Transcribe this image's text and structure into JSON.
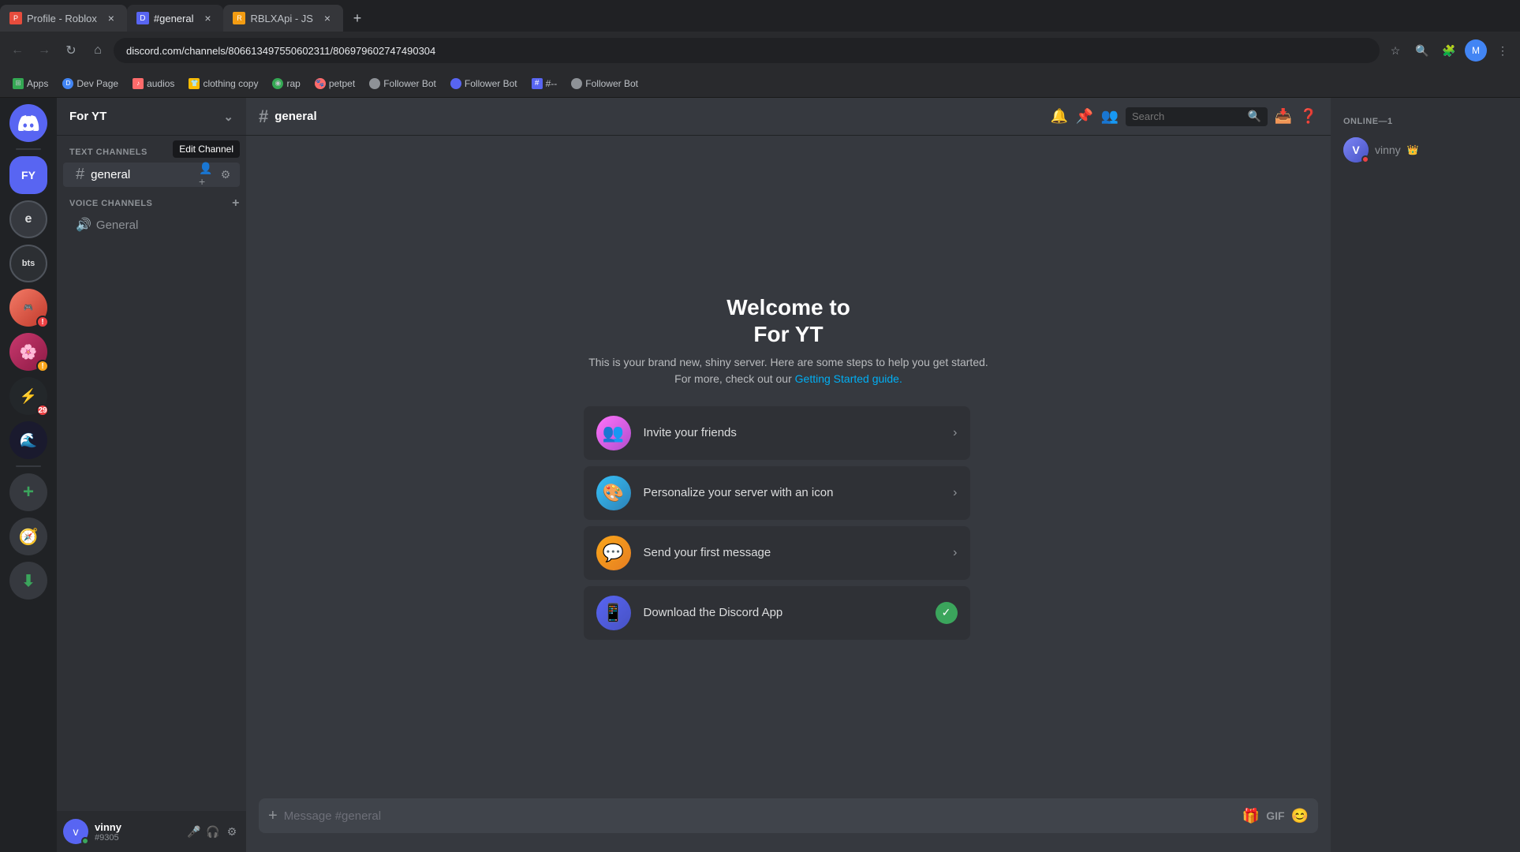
{
  "browser": {
    "tabs": [
      {
        "id": "tab1",
        "title": "Profile - Roblox",
        "url": "",
        "active": false,
        "favicon_color": "#e74c3c"
      },
      {
        "id": "tab2",
        "title": "#general",
        "url": "discord.com/channels/806613497550602311/806979602747490304",
        "active": true,
        "favicon_color": "#5865f2"
      },
      {
        "id": "tab3",
        "title": "RBLXApi - JS",
        "url": "",
        "active": false,
        "favicon_color": "#f39c12"
      }
    ],
    "address": "discord.com/channels/806613497550602311/806979602747490304",
    "bookmarks": [
      {
        "label": "Apps",
        "icon_color": "#34a853"
      },
      {
        "label": "Dev Page",
        "icon_color": "#4285f4"
      },
      {
        "label": "audios",
        "icon_color": "#ea4335"
      },
      {
        "label": "clothing copy",
        "icon_color": "#fbbc04"
      },
      {
        "label": "rap",
        "icon_color": "#34a853"
      },
      {
        "label": "petpet",
        "icon_color": "#ea4335"
      },
      {
        "label": "Follower Bot",
        "icon_color": "#8e9297"
      },
      {
        "label": "Follower Bot",
        "icon_color": "#8e9297"
      },
      {
        "label": "#--",
        "icon_color": "#5865f2"
      },
      {
        "label": "Follower Bot",
        "icon_color": "#8e9297"
      }
    ]
  },
  "discord": {
    "server_name": "For YT",
    "channel_name": "general",
    "channel_hash": "#",
    "text_channels_label": "Text Channels",
    "voice_channels_label": "Voice Channels",
    "text_channels": [
      {
        "name": "general",
        "active": true
      }
    ],
    "voice_channels": [
      {
        "name": "General"
      }
    ],
    "edit_channel_tooltip": "Edit Channel",
    "welcome_title": "Welcome to\nFor YT",
    "welcome_line1": "Welcome to",
    "welcome_line2": "For YT",
    "welcome_desc": "This is your brand new, shiny server. Here are some steps to help you get started. For more, check out our",
    "welcome_link": "Getting Started guide.",
    "action_cards": [
      {
        "id": "invite",
        "label": "Invite your friends",
        "icon": "👥",
        "icon_class": "invite",
        "complete": false
      },
      {
        "id": "personalize",
        "label": "Personalize your server with an icon",
        "icon": "🎨",
        "icon_class": "personalize",
        "complete": false
      },
      {
        "id": "message",
        "label": "Send your first message",
        "icon": "💬",
        "icon_class": "message",
        "complete": false
      },
      {
        "id": "download",
        "label": "Download the Discord App",
        "icon": "📱",
        "icon_class": "download",
        "complete": true
      }
    ],
    "message_placeholder": "Message #general",
    "online_header": "Online—1",
    "online_members": [
      {
        "name": "vinny",
        "status": "dnd"
      }
    ],
    "user": {
      "name": "vinny",
      "discriminator": "#9305",
      "avatar_text": "v"
    },
    "search_placeholder": "Search"
  }
}
